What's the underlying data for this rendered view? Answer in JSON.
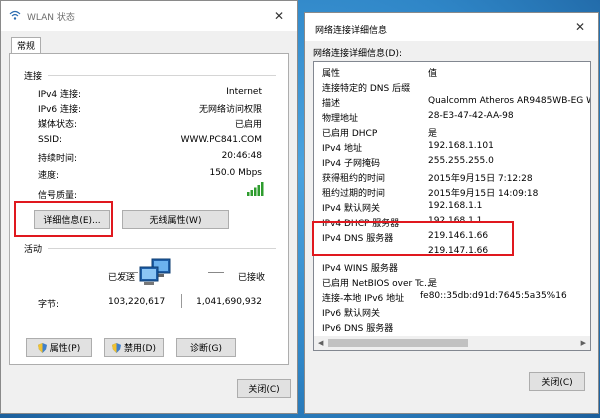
{
  "wlan": {
    "title": "WLAN 状态",
    "tab": "常规",
    "connection_header": "连接",
    "fields": [
      {
        "label": "IPv4 连接:",
        "value": "Internet"
      },
      {
        "label": "IPv6 连接:",
        "value": "无网络访问权限"
      },
      {
        "label": "媒体状态:",
        "value": "已启用"
      },
      {
        "label": "SSID:",
        "value": "WWW.PC841.COM"
      },
      {
        "label": "持续时间:",
        "value": "20:46:48"
      },
      {
        "label": "速度:",
        "value": "150.0 Mbps"
      }
    ],
    "signal_label": "信号质量:",
    "details_button": "详细信息(E)...",
    "wireless_props_button": "无线属性(W)",
    "activity_header": "活动",
    "sent_label": "已发送",
    "received_label": "已接收",
    "bytes_label": "字节:",
    "bytes_sent": "103,220,617",
    "bytes_received": "1,041,690,932",
    "properties_button": "属性(P)",
    "disable_button": "禁用(D)",
    "diagnose_button": "诊断(G)",
    "close_button": "关闭(C)"
  },
  "details": {
    "title": "网络连接详细信息",
    "list_label": "网络连接详细信息(D):",
    "col_property": "属性",
    "col_value": "值",
    "rows": [
      {
        "p": "连接特定的 DNS 后缀",
        "v": ""
      },
      {
        "p": "描述",
        "v": "Qualcomm Atheros AR9485WB-EG Wire"
      },
      {
        "p": "物理地址",
        "v": "28-E3-47-42-AA-98"
      },
      {
        "p": "已启用 DHCP",
        "v": "是"
      },
      {
        "p": "IPv4 地址",
        "v": "192.168.1.101"
      },
      {
        "p": "IPv4 子网掩码",
        "v": "255.255.255.0"
      },
      {
        "p": "获得租约的时间",
        "v": "2015年9月15日 7:12:28"
      },
      {
        "p": "租约过期的时间",
        "v": "2015年9月15日 14:09:18"
      },
      {
        "p": "IPv4 默认网关",
        "v": "192.168.1.1"
      },
      {
        "p": "IPv4 DHCP 服务器",
        "v": "192.168.1.1"
      },
      {
        "p": "IPv4 DNS 服务器",
        "v": "219.146.1.66"
      },
      {
        "p": "",
        "v": "219.147.1.66"
      },
      {
        "p": "IPv4 WINS 服务器",
        "v": ""
      },
      {
        "p": "已启用 NetBIOS over Tc...",
        "v": "是"
      },
      {
        "p": "连接-本地 IPv6 地址",
        "v": "fe80::35db:d91d:7645:5a35%16"
      },
      {
        "p": "IPv6 默认网关",
        "v": ""
      },
      {
        "p": "IPv6 DNS 服务器",
        "v": ""
      }
    ],
    "close_button": "关闭(C)"
  },
  "colors": {
    "highlight": "#e0181e",
    "desktop": "#2f86c7",
    "signal": "#2e9c2e"
  }
}
